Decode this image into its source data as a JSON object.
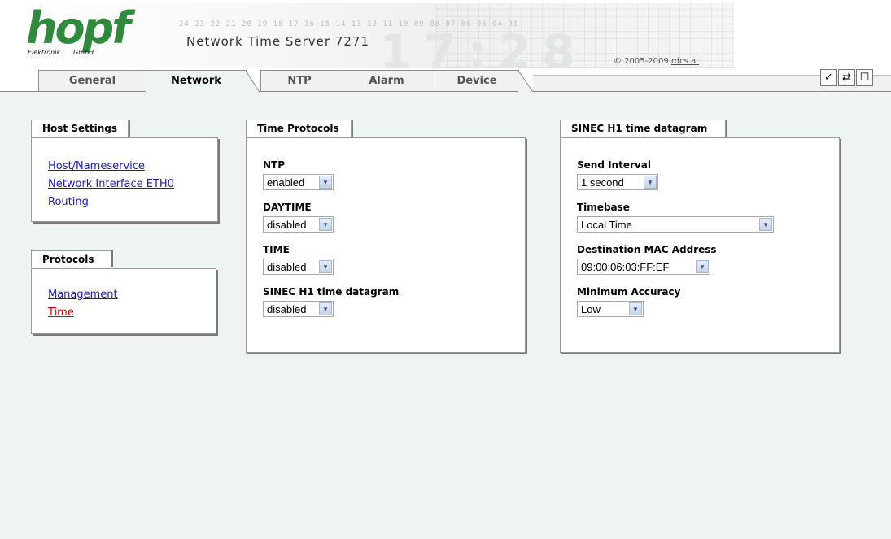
{
  "header": {
    "logo_text": "hopf",
    "logo_left": "Elektronik",
    "logo_right": "GmbH",
    "digits": "24 23 22 21 20 19 18 17 16 15 14 13 12 11 10 09 08 07 06 05 04 01",
    "product": "Network Time Server 7271",
    "copyright_prefix": "© 2005-2009",
    "copyright_link": "rdcs.at"
  },
  "tabs": [
    {
      "label": "General",
      "active": false
    },
    {
      "label": "Network",
      "active": true
    },
    {
      "label": "NTP",
      "active": false
    },
    {
      "label": "Alarm",
      "active": false
    },
    {
      "label": "Device",
      "active": false
    }
  ],
  "toolbar": {
    "apply_glyph": "✓",
    "reload_glyph": "⇄",
    "save_glyph": "☐"
  },
  "host_settings": {
    "title": "Host Settings",
    "links": [
      "Host/Nameservice",
      "Network Interface ETH0",
      "Routing"
    ]
  },
  "protocols": {
    "title": "Protocols",
    "links": [
      "Management",
      "Time"
    ]
  },
  "time_protocols": {
    "title": "Time Protocols",
    "fields": [
      {
        "label": "NTP",
        "value": "enabled"
      },
      {
        "label": "DAYTIME",
        "value": "disabled"
      },
      {
        "label": "TIME",
        "value": "disabled"
      },
      {
        "label": "SINEC H1 time datagram",
        "value": "disabled"
      }
    ]
  },
  "sinec": {
    "title": "SINEC H1 time datagram",
    "fields": [
      {
        "label": "Send Interval",
        "value": "1 second"
      },
      {
        "label": "Timebase",
        "value": "Local Time"
      },
      {
        "label": "Destination MAC Address",
        "value": "09:00:06:03:FF:EF"
      },
      {
        "label": "Minimum Accuracy",
        "value": "Low"
      }
    ]
  },
  "colors": {
    "content_bg": "#eef4f1",
    "link": "#1a1acc",
    "active_link": "#e00000",
    "logo": "#2f8a3c"
  }
}
